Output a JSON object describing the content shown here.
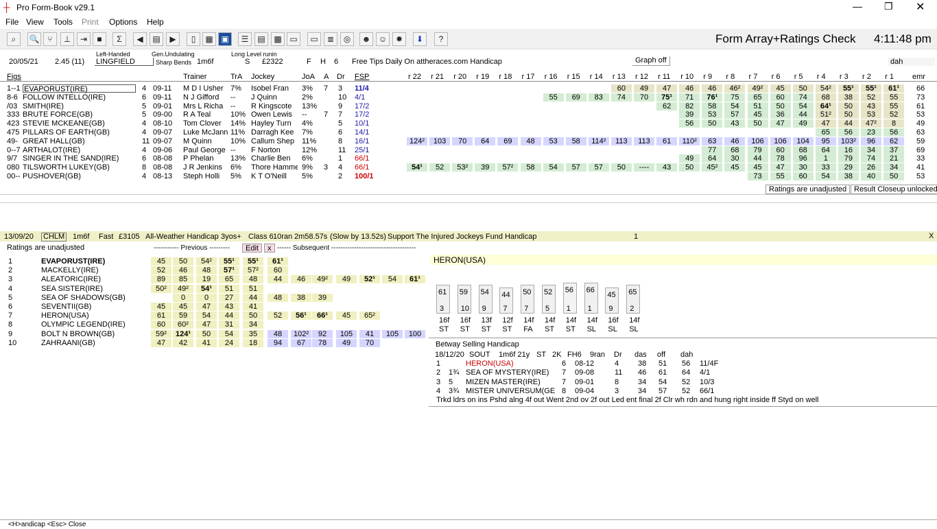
{
  "window": {
    "title": "Pro Form-Book v29.1"
  },
  "menu": [
    "File",
    "View",
    "Tools",
    "Print",
    "Options",
    "Help"
  ],
  "toolbar": {
    "title": "Form Array+Ratings Check",
    "time": "4:11:48 pm"
  },
  "race": {
    "date": "20/05/21",
    "time": "2.45 (11)",
    "track_type": "Left-Handed",
    "course": "LINGFIELD",
    "going_type": "Gen.Undulating",
    "bends": "Sharp Bends",
    "dist": "1m6f",
    "run": "Long Level runin",
    "s": "S",
    "prize": "£2322",
    "f": "F",
    "h": "H",
    "n": "6",
    "name": "Free Tips Daily On attheraces.com Handicap",
    "graph": "Graph off",
    "dah": "dah"
  },
  "headers": {
    "figs": "Figs",
    "trainer": "Trainer",
    "tra": "TrA",
    "jockey": "Jockey",
    "joa": "JoA",
    "a": "A",
    "dr": "Dr",
    "fsp": "FSP",
    "rs": [
      "r 22",
      "r 21",
      "r 20",
      "r 19",
      "r 18",
      "r 17",
      "r 16",
      "r 15",
      "r 14",
      "r 13",
      "r 12",
      "r 11",
      "r 10",
      "r 9",
      "r 8",
      "r 7",
      "r 6",
      "r 5",
      "r 4",
      "r 3",
      "r 2",
      "r 1"
    ],
    "emr": "emr"
  },
  "runners": [
    {
      "figs": "1--1",
      "horse": "EVAPORUST(IRE)",
      "age": "4",
      "wt": "09-11",
      "trainer": "M D I Usher",
      "tra": "7%",
      "jockey": "Isobel Fran",
      "joa": "3%",
      "a": "7",
      "dr": "3",
      "fsp": "11/4",
      "r": {
        "r13": "60",
        "r12": "49",
        "r11": "47",
        "r10": "46",
        "r9": "46",
        "r8": "46²",
        "r7": "49²",
        "r6": "45",
        "r5": "50",
        "r4": "54²",
        "r3": "55¹",
        "r2": "55¹",
        "r1": "61¹"
      },
      "emr": "66"
    },
    {
      "figs": "8-6",
      "horse": "FOLLOW INTELLO(IRE)",
      "age": "6",
      "wt": "09-11",
      "trainer": "N J Gifford",
      "tra": "--",
      "jockey": "J Quinn",
      "joa": "2%",
      "a": "",
      "dr": "10",
      "fsp": "4/1",
      "r": {
        "r16": "55",
        "r15": "69",
        "r14": "83",
        "r13": "74",
        "r12": "70",
        "r11": "75¹",
        "r10": "71",
        "r9": "76¹",
        "r8": "75",
        "r7": "65",
        "r6": "60",
        "r5": "74",
        "r4": "68",
        "r3": "38",
        "r2": "52",
        "r1": "55"
      },
      "emr": "73"
    },
    {
      "figs": "/03",
      "horse": "SMITH(IRE)",
      "age": "5",
      "wt": "09-01",
      "trainer": "Mrs L Richa",
      "tra": "--",
      "jockey": "R Kingscote",
      "joa": "13%",
      "a": "",
      "dr": "9",
      "fsp": "17/2",
      "r": {
        "r11": "62",
        "r10": "82",
        "r9": "58",
        "r8": "54",
        "r7": "51",
        "r6": "50",
        "r5": "54",
        "r4": "64¹",
        "r3": "50",
        "r2": "43",
        "r1": "55"
      },
      "emr": "61"
    },
    {
      "figs": "333",
      "horse": "BRUTE FORCE(GB)",
      "age": "5",
      "wt": "09-00",
      "trainer": "R A Teal",
      "tra": "10%",
      "jockey": "Owen Lewis",
      "joa": "--",
      "a": "7",
      "dr": "7",
      "fsp": "17/2",
      "r": {
        "r10": "39",
        "r9": "53",
        "r8": "57",
        "r7": "45",
        "r6": "36",
        "r5": "44",
        "r4": "51²",
        "r3": "50",
        "r2": "53",
        "r1": "52"
      },
      "emr": "53"
    },
    {
      "figs": "423",
      "horse": "STEVIE MCKEANE(GB)",
      "age": "4",
      "wt": "08-10",
      "trainer": "Tom Clover",
      "tra": "14%",
      "jockey": "Hayley Turn",
      "joa": "4%",
      "a": "",
      "dr": "5",
      "fsp": "10/1",
      "r": {
        "r10": "56",
        "r9": "50",
        "r8": "43",
        "r7": "50",
        "r6": "47",
        "r5": "49",
        "r4": "47",
        "r3": "44",
        "r2": "47²",
        "r1": "8"
      },
      "emr": "49"
    },
    {
      "figs": "475",
      "horse": "PILLARS OF EARTH(GB)",
      "age": "4",
      "wt": "09-07",
      "trainer": "Luke McJann",
      "tra": "11%",
      "jockey": "Darragh Kee",
      "joa": "7%",
      "a": "",
      "dr": "6",
      "fsp": "14/1",
      "r": {
        "r4": "65",
        "r3": "56",
        "r2": "23",
        "r1": "56"
      },
      "emr": "63"
    },
    {
      "figs": "49-",
      "horse": "GREAT HALL(GB)",
      "age": "11",
      "wt": "09-07",
      "trainer": "M Quinn",
      "tra": "10%",
      "jockey": "Callum Shep",
      "joa": "11%",
      "a": "",
      "dr": "8",
      "fsp": "16/1",
      "r": {
        "r22": "124²",
        "r21": "103",
        "r20": "70",
        "r19": "64",
        "r18": "69",
        "r17": "48",
        "r16": "53",
        "r15": "58",
        "r14": "114²",
        "r13": "113",
        "r12": "113",
        "r11": "61",
        "r10": "110²",
        "r9": "63",
        "r8": "46",
        "r7": "106",
        "r6": "106",
        "r5": "104",
        "r4": "95",
        "r3": "103²",
        "r2": "96",
        "r1": "62"
      },
      "emr": "59"
    },
    {
      "figs": "0--7",
      "horse": "ARTHALOT(IRE)",
      "age": "4",
      "wt": "09-06",
      "trainer": "Paul George",
      "tra": "--",
      "jockey": "F Norton",
      "joa": "12%",
      "a": "",
      "dr": "11",
      "fsp": "25/1",
      "r": {
        "r9": "77",
        "r8": "68",
        "r7": "79",
        "r6": "60",
        "r5": "68",
        "r4": "64",
        "r3": "16",
        "r2": "34",
        "r1": "37"
      },
      "emr": "69"
    },
    {
      "figs": "9/7",
      "horse": "SINGER IN THE SAND(IRE)",
      "age": "6",
      "wt": "08-08",
      "trainer": "P Phelan",
      "tra": "13%",
      "jockey": "Charlie Ben",
      "joa": "6%",
      "a": "",
      "dr": "1",
      "fsp": "66/1",
      "r": {
        "r10": "49",
        "r9": "64",
        "r8": "30",
        "r7": "44",
        "r6": "78",
        "r5": "96",
        "r4": "1",
        "r3": "79",
        "r2": "74",
        "r1": "21"
      },
      "emr": "33"
    },
    {
      "figs": "080",
      "horse": "TILSWORTH LUKEY(GB)",
      "age": "8",
      "wt": "08-08",
      "trainer": "J R Jenkins",
      "tra": "6%",
      "jockey": "Thore Hamme",
      "joa": "9%",
      "a": "3",
      "dr": "4",
      "fsp": "66/1",
      "r": {
        "r22": "54¹",
        "r21": "52",
        "r20": "53²",
        "r19": "39",
        "r18": "57²",
        "r17": "58",
        "r16": "54",
        "r15": "57",
        "r14": "57",
        "r13": "50",
        "r12": "----",
        "r11": "43",
        "r10": "50",
        "r9": "45²",
        "r8": "45",
        "r7": "45",
        "r6": "47",
        "r5": "30",
        "r4": "33",
        "r3": "29",
        "r2": "26",
        "r1": "34"
      },
      "emr": "41"
    },
    {
      "figs": "00--",
      "horse": "PUSHOVER(GB)",
      "age": "4",
      "wt": "08-13",
      "trainer": "Steph Holli",
      "tra": "5%",
      "jockey": "K T O'Neill",
      "joa": "5%",
      "a": "",
      "dr": "2",
      "fsp": "100/1",
      "r": {
        "r7": "73",
        "r6": "55",
        "r5": "60",
        "r4": "54",
        "r3": "38",
        "r2": "40",
        "r1": "50"
      },
      "emr": "53"
    }
  ],
  "status": {
    "ratings": "Ratings are unadjusted",
    "closeup": "Result Closeup unlocked"
  },
  "result": {
    "date": "13/09/20",
    "course": "CHLM",
    "dist": "1m6f",
    "going": "Fast",
    "prize": "£3105",
    "type": "All-Weather Handicap",
    "age": "3yos+",
    "cls": "Class 6",
    "ran": "10ran",
    "time": "2m58.57s",
    "slow": "(Slow by 13.52s)",
    "name": "Support The Injured Jockeys Fund Handicap",
    "one": "1",
    "close": "X"
  },
  "panel": {
    "unadj": "Ratings are unadjusted",
    "previous": "----------- Previous ---------",
    "edit": "Edit",
    "x": "x",
    "subsequent": "------ Subsequent -------------------------------------"
  },
  "finishers": [
    {
      "pos": "1",
      "name": "EVAPORUST(IRE)",
      "prev": [
        "45",
        "50",
        "54²",
        "55¹",
        "55¹",
        "61¹"
      ],
      "bold": true
    },
    {
      "pos": "2",
      "name": "MACKELLY(IRE)",
      "prev": [
        "52",
        "46",
        "48",
        "57¹",
        "57²",
        "60"
      ]
    },
    {
      "pos": "3",
      "name": "ALEATORIC(IRE)",
      "prev": [
        "89",
        "85",
        "19",
        "65",
        "48",
        "44",
        "46",
        "49²",
        "49",
        "52¹",
        "54",
        "61¹"
      ]
    },
    {
      "pos": "4",
      "name": "SEA SISTER(IRE)",
      "prev": [
        "50²",
        "49²",
        "54¹",
        "51",
        "51"
      ]
    },
    {
      "pos": "5",
      "name": "SEA OF SHADOWS(GB)",
      "prev": [
        "",
        "0",
        "0",
        "27",
        "44",
        "48",
        "38",
        "39"
      ]
    },
    {
      "pos": "6",
      "name": "SEVENTII(GB)",
      "prev": [
        "45",
        "45",
        "47",
        "43",
        "41"
      ]
    },
    {
      "pos": "7",
      "name": "HERON(USA)",
      "prev": [
        "61",
        "59",
        "54",
        "44",
        "50",
        "52",
        "56¹",
        "66¹",
        "45",
        "65²"
      ]
    },
    {
      "pos": "8",
      "name": "OLYMPIC LEGEND(IRE)",
      "prev": [
        "60",
        "60²",
        "47",
        "31",
        "34"
      ]
    },
    {
      "pos": "9",
      "name": "BOLT N BROWN(GB)",
      "prev": [
        "59²",
        "124¹",
        "50",
        "54",
        "35",
        "48",
        "102²",
        "92",
        "105",
        "41",
        "105",
        "100"
      ]
    },
    {
      "pos": "10",
      "name": "ZAHRAANI(GB)",
      "prev": [
        "47",
        "42",
        "41",
        "24",
        "18",
        "94",
        "67",
        "78",
        "49",
        "70"
      ]
    }
  ],
  "heron": {
    "name": "HERON(USA)",
    "runs": [
      {
        "r": "61",
        "p": "3",
        "d": "16f",
        "g": "ST"
      },
      {
        "r": "59",
        "p": "10",
        "d": "16f",
        "g": "ST"
      },
      {
        "r": "54",
        "p": "9",
        "d": "13f",
        "g": "ST"
      },
      {
        "r": "44",
        "p": "7",
        "d": "12f",
        "g": "ST"
      },
      {
        "r": "50",
        "p": "7",
        "d": "14f",
        "g": "FA"
      },
      {
        "r": "52",
        "p": "5",
        "d": "14f",
        "g": "ST"
      },
      {
        "r": "56",
        "p": "1",
        "d": "14f",
        "g": "ST"
      },
      {
        "r": "66",
        "p": "1",
        "d": "14f",
        "g": "SL"
      },
      {
        "r": "45",
        "p": "9",
        "d": "16f",
        "g": "SL"
      },
      {
        "r": "65",
        "p": "2",
        "d": "14f",
        "g": "SL"
      }
    ]
  },
  "betway": {
    "title": "Betway Selling Handicap",
    "hdr": [
      "18/12/20",
      "SOUT",
      "1m6f 21y",
      "ST",
      "2K",
      "FH6",
      "9ran",
      "Dr",
      "das",
      "off",
      "dah"
    ],
    "rows": [
      [
        "1",
        "",
        "HERON(USA)",
        "6",
        "08-12",
        "4",
        "38",
        "51",
        "56",
        "11/4F"
      ],
      [
        "2",
        "1¾",
        "SEA OF MYSTERY(IRE)",
        "7",
        "09-08",
        "11",
        "46",
        "61",
        "64",
        "4/1"
      ],
      [
        "3",
        "5",
        "MIZEN MASTER(IRE)",
        "7",
        "09-01",
        "8",
        "34",
        "54",
        "52",
        "10/3"
      ],
      [
        "4",
        "3¾",
        "MISTER UNIVERSUM(GE",
        "8",
        "09-04",
        "3",
        "34",
        "57",
        "52",
        "66/1"
      ]
    ],
    "comment": "Trkd ldrs on ins Pshd alng 4f out Went 2nd ov 2f out Led ent final 2f Clr wh rdn and hung right inside ff Styd on well"
  },
  "footer": "<H>andicap <Esc> Close"
}
